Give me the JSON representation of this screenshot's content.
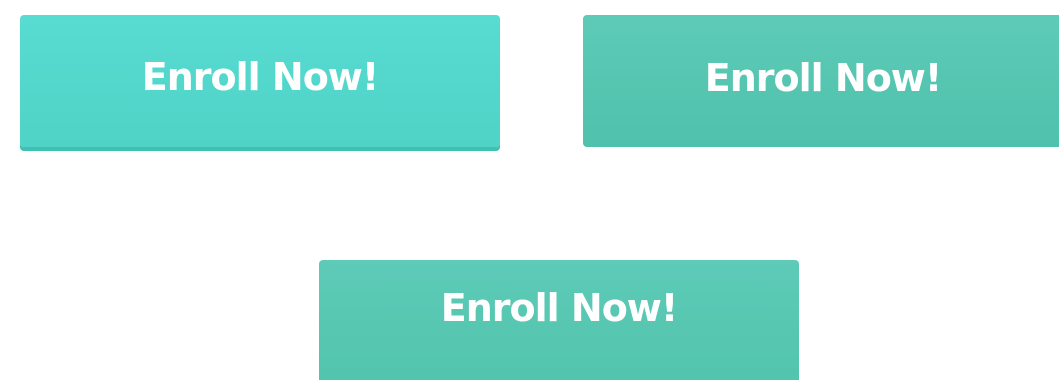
{
  "buttons": [
    {
      "label": "Enroll Now!",
      "state": "default",
      "color": "#54d8cc"
    },
    {
      "label": "Enroll Now!",
      "state": "hover",
      "color": "#55c6b1"
    },
    {
      "label": "Enroll Now!",
      "state": "active",
      "color": "#55c6b1"
    }
  ]
}
